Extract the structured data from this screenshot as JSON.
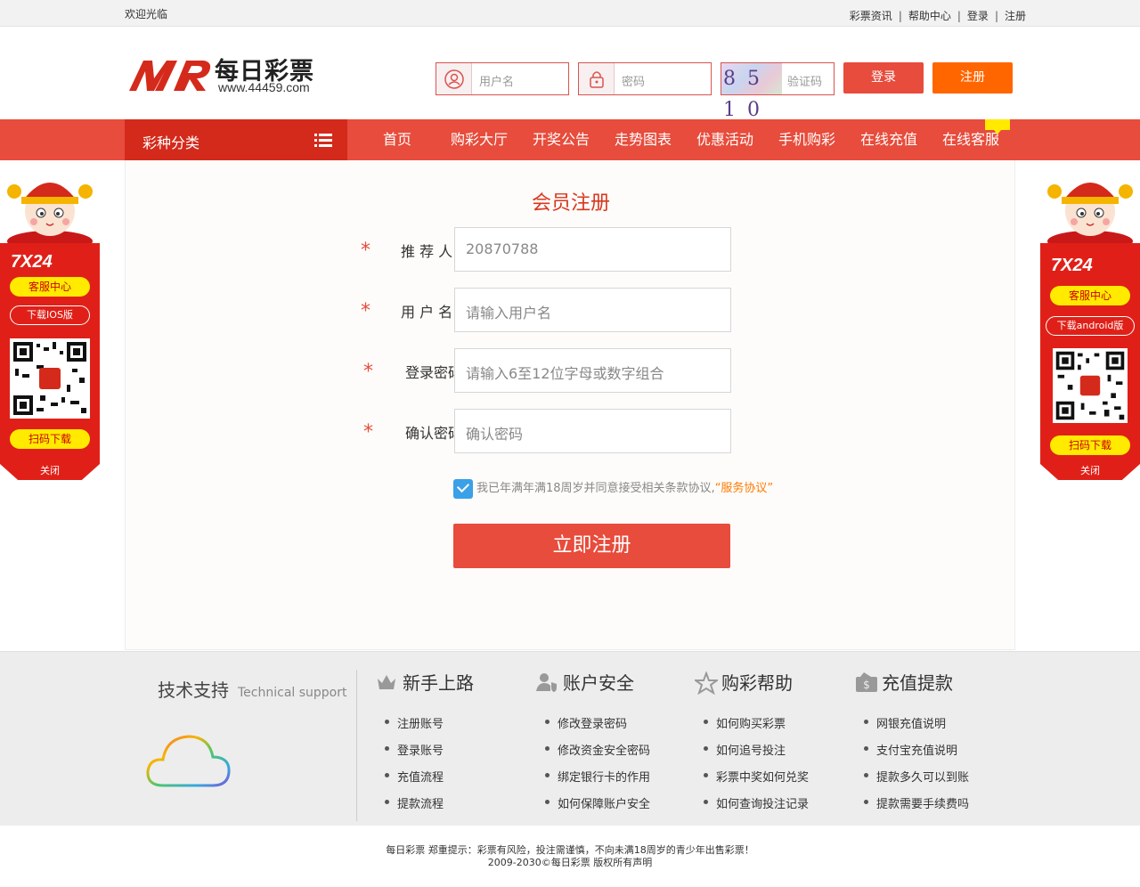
{
  "topbar": {
    "welcome": "欢迎光临",
    "links": [
      "彩票资讯",
      "帮助中心",
      "登录",
      "注册"
    ]
  },
  "header": {
    "brand": "每日彩票",
    "site": "www.44459.com",
    "username_placeholder": "用户名",
    "password_placeholder": "密码",
    "captcha_text": "8 5 1 0",
    "captcha_placeholder": "验证码",
    "login_label": "登录",
    "register_label": "注册"
  },
  "nav": {
    "category_label": "彩种分类",
    "items": [
      "首页",
      "购彩大厅",
      "开奖公告",
      "走势图表",
      "优惠活动",
      "手机购彩",
      "在线充值",
      "在线客服"
    ]
  },
  "form": {
    "title": "会员注册",
    "fields": [
      {
        "label": "推 荐 人",
        "value": "20870788"
      },
      {
        "label": "用 户 名",
        "value": "请输入用户名"
      },
      {
        "label": "登录密码",
        "value": "请输入6至12位字母或数字组合"
      },
      {
        "label": "确认密码",
        "value": "确认密码"
      }
    ],
    "agree_text": "我已年满年满18周岁并同意接受相关条款协议,",
    "agree_link": "“服务协议”",
    "submit_label": "立即注册"
  },
  "side_left": {
    "hours": "7X24",
    "btn1": "客服中心",
    "btn2": "下载IOS版",
    "btn3": "扫码下载",
    "close": "关闭"
  },
  "side_right": {
    "hours": "7X24",
    "btn1": "客服中心",
    "btn2": "下载android版",
    "btn3": "扫码下载",
    "close": "关闭"
  },
  "footer": {
    "support_title": "技术支持",
    "support_sub": "Technical support",
    "columns": [
      {
        "title": "新手上路",
        "items": [
          "注册账号",
          "登录账号",
          "充值流程",
          "提款流程"
        ]
      },
      {
        "title": "账户安全",
        "items": [
          "修改登录密码",
          "修改资金安全密码",
          "绑定银行卡的作用",
          "如何保障账户安全"
        ]
      },
      {
        "title": "购彩帮助",
        "items": [
          "如何购买彩票",
          "如何追号投注",
          "彩票中奖如何兑奖",
          "如何查询投注记录"
        ]
      },
      {
        "title": "充值提款",
        "items": [
          "网银充值说明",
          "支付宝充值说明",
          "提款多久可以到账",
          "提款需要手续费吗"
        ]
      }
    ],
    "copyright1": "每日彩票 郑重提示：彩票有风险，投注需谨慎，不向未满18周岁的青少年出售彩票！",
    "copyright2": "2009-2030©每日彩票 版权所有声明"
  }
}
